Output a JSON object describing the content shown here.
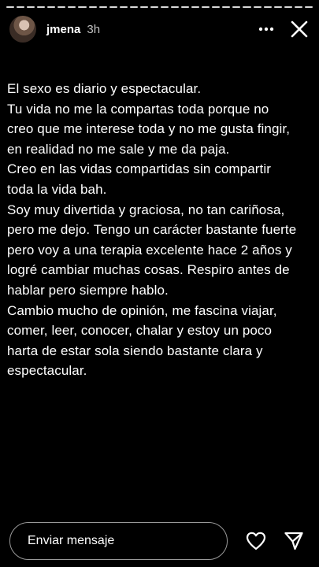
{
  "header": {
    "username": "jmena",
    "time": "3h",
    "more_icon": "more-horizontal-icon",
    "close_icon": "close-icon"
  },
  "progress": {
    "segments": 30
  },
  "story": {
    "lines": [
      "El sexo es diario y espectacular.",
      "Tu vida no me la compartas toda porque no",
      "creo que me interese toda y no me gusta fingir,",
      "en realidad no me sale y me da paja.",
      "Creo en las vidas compartidas sin compartir",
      "toda la vida bah.",
      "Soy muy divertida y graciosa, no tan cariñosa,",
      "pero me dejo. Tengo un carácter bastante fuerte",
      "pero voy a una terapia excelente hace 2 años y",
      "logré cambiar muchas cosas. Respiro antes de",
      "hablar pero siempre hablo.",
      "Cambio mucho de opinión, me fascina viajar,",
      "comer, leer, conocer, chalar y estoy un poco",
      "harta de estar sola siendo bastante clara y",
      "espectacular."
    ]
  },
  "footer": {
    "message_placeholder": "Enviar mensaje",
    "heart_icon": "heart-icon",
    "send_icon": "send-icon"
  },
  "colors": {
    "background": "#000000",
    "text": "#ffffff"
  }
}
